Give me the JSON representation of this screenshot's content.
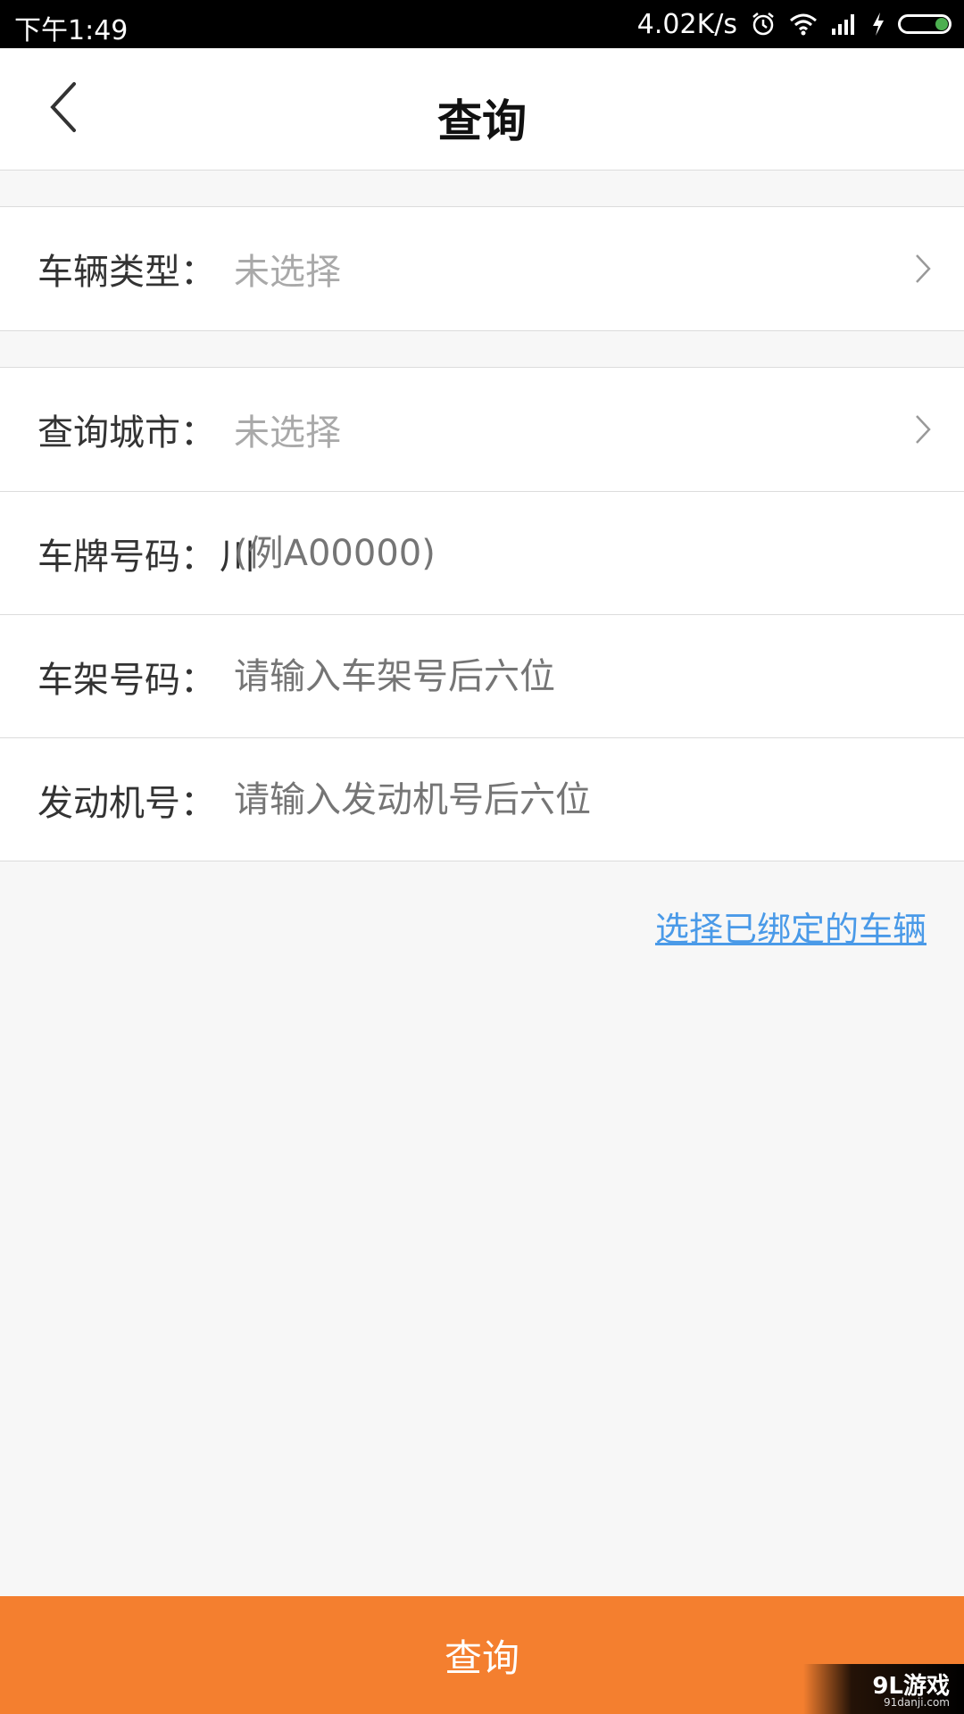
{
  "status_bar": {
    "time": "下午1:49",
    "net_speed": "4.02K/s",
    "icons": [
      "alarm-icon",
      "wifi-icon",
      "signal-icon",
      "charging-icon",
      "battery-icon"
    ]
  },
  "navbar": {
    "back_icon": "chevron-left-icon",
    "title": "查询"
  },
  "form": {
    "vehicle_type": {
      "label": "车辆类型：",
      "value": "未选择"
    },
    "query_city": {
      "label": "查询城市：",
      "value": "未选择"
    },
    "plate_number": {
      "label": "车牌号码：",
      "prefix": "川",
      "placeholder": "(例A00000)"
    },
    "frame_number": {
      "label": "车架号码：",
      "placeholder": "请输入车架号后六位"
    },
    "engine_number": {
      "label": "发动机号：",
      "placeholder": "请输入发动机号后六位"
    }
  },
  "links": {
    "select_bound_vehicle": "选择已绑定的车辆"
  },
  "footer": {
    "query_button": "查询"
  },
  "watermark": {
    "main": "9L游戏",
    "sub": "91danji.com"
  },
  "colors": {
    "accent": "#f47f2f",
    "link": "#4a9ae8",
    "battery": "#4caf50"
  }
}
